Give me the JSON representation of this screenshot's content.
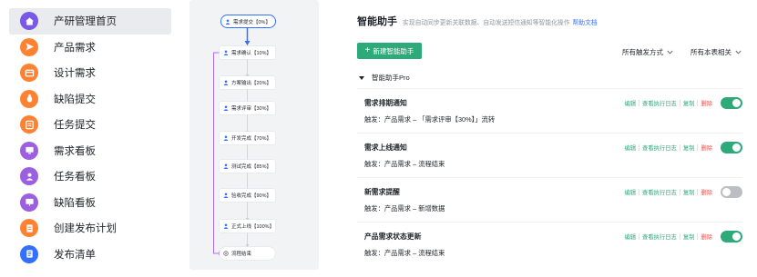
{
  "colors": {
    "accent_green": "#2ea97a",
    "link_blue": "#3370ff",
    "danger_red": "#f54a45",
    "flow_purple": "#b26de6"
  },
  "sidebar": {
    "items": [
      {
        "label": "产研管理首页",
        "icon": "home-icon",
        "color": "#7b57e8",
        "active": true
      },
      {
        "label": "产品需求",
        "icon": "send-icon",
        "color": "#ff8233"
      },
      {
        "label": "设计需求",
        "icon": "card-icon",
        "color": "#ff8233"
      },
      {
        "label": "缺陷提交",
        "icon": "bug-icon",
        "color": "#ff8233"
      },
      {
        "label": "任务提交",
        "icon": "pencil-icon",
        "color": "#ff8233"
      },
      {
        "label": "需求看板",
        "icon": "monitor-icon",
        "color": "#9b5fe0"
      },
      {
        "label": "任务看板",
        "icon": "person-board-icon",
        "color": "#9b5fe0"
      },
      {
        "label": "缺陷看板",
        "icon": "board-icon",
        "color": "#9b5fe0"
      },
      {
        "label": "创建发布计划",
        "icon": "plan-icon",
        "color": "#ff8233"
      },
      {
        "label": "发布清单",
        "icon": "list-icon",
        "color": "#3370ff"
      }
    ]
  },
  "flow": {
    "nodes": [
      {
        "label": "需求提交【0%】",
        "kind": "start"
      },
      {
        "label": "需求确认【10%】",
        "kind": "step"
      },
      {
        "label": "方案输出【20%】",
        "kind": "step"
      },
      {
        "label": "需求评审【30%】",
        "kind": "step"
      },
      {
        "label": "开发完成【70%】",
        "kind": "step"
      },
      {
        "label": "测试完成【85%】",
        "kind": "step"
      },
      {
        "label": "验收完成【90%】",
        "kind": "step"
      },
      {
        "label": "正式上线【100%】",
        "kind": "step"
      },
      {
        "label": "流程结束",
        "kind": "end"
      }
    ]
  },
  "main": {
    "title": "智能助手",
    "description": "实现自动同步更新关联数据、自动发送短信通知等智能化操作",
    "help_link": "帮助文档",
    "new_button": "新建智能助手",
    "filter_trigger": "所有触发方式",
    "filter_table": "所有本表相关",
    "group_label": "智能助手Pro",
    "actions": {
      "edit": "编辑",
      "log": "查看执行日志",
      "copy": "复制",
      "delete": "删除"
    },
    "assistants": [
      {
        "title": "需求排期通知",
        "trigger": "触发：产品需求 – 「需求评审【30%】」流转",
        "enabled": true
      },
      {
        "title": "需求上线通知",
        "trigger": "触发：产品需求 – 流程结束",
        "enabled": true
      },
      {
        "title": "新需求提醒",
        "trigger": "触发：产品需求 – 新增数据",
        "enabled": false
      },
      {
        "title": "产品需求状态更新",
        "trigger": "触发：产品需求 – 流程结束",
        "enabled": true
      }
    ]
  }
}
